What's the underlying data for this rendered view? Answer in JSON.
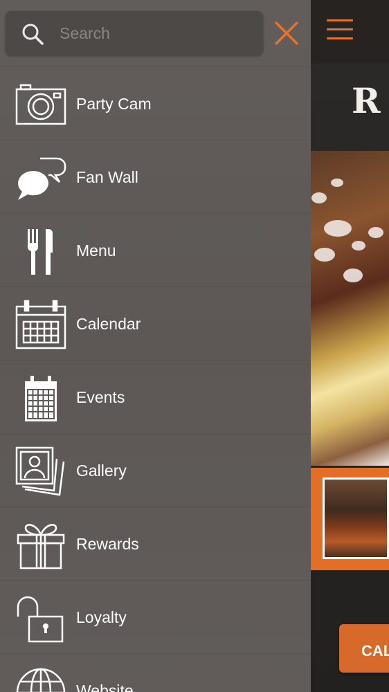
{
  "search": {
    "placeholder": "Search"
  },
  "menu": {
    "items": [
      {
        "label": "Party Cam",
        "icon": "camera-icon"
      },
      {
        "label": "Fan Wall",
        "icon": "chat-bubbles-icon"
      },
      {
        "label": "Menu",
        "icon": "fork-knife-icon"
      },
      {
        "label": "Calendar",
        "icon": "calendar-icon"
      },
      {
        "label": "Events",
        "icon": "events-calendar-icon"
      },
      {
        "label": "Gallery",
        "icon": "photos-icon"
      },
      {
        "label": "Rewards",
        "icon": "gift-icon"
      },
      {
        "label": "Loyalty",
        "icon": "unlocked-padlock-icon"
      },
      {
        "label": "Website",
        "icon": "globe-icon"
      }
    ]
  },
  "app": {
    "logo_text": "R",
    "call_button_label": "CAL"
  },
  "colors": {
    "accent": "#e5742a",
    "drawer_bg": "#5f5a58",
    "search_bg": "#4d4947",
    "label_text": "#fbfbfb"
  }
}
